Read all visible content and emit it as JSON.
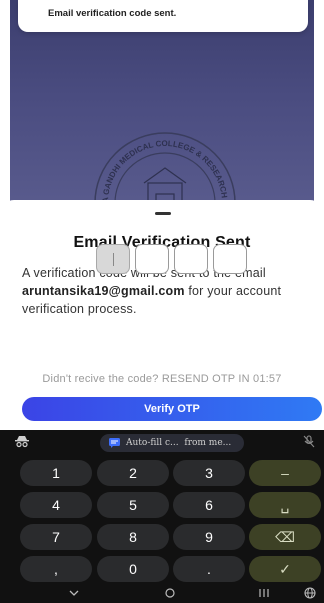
{
  "toast": {
    "message": "Email verification code sent."
  },
  "logo": {
    "text": "A GANDHI MEDICAL COLLEGE & RESEARCH INSTITUTE"
  },
  "sheet": {
    "title": "Email Verification Sent",
    "description_prefix": "A verification code will be sent to the email ",
    "email": "aruntansika19@gmail.com",
    "description_suffix": " for your account verification process.",
    "otp_digits": [
      "",
      "",
      "",
      ""
    ],
    "resend_text": "Didn't recive the code? RESEND OTP IN 01:57",
    "verify_button": "Verify OTP",
    "button_colors": [
      "#3b44e6",
      "#2f7af4"
    ]
  },
  "keyboard": {
    "toolbar": {
      "autofill_label": "Auto-fill c...",
      "autofill_source": "from me...",
      "icons": [
        "incognito-icon",
        "message-icon",
        "mic-off-icon"
      ]
    },
    "keys": {
      "k1": "1",
      "k2": "2",
      "k3": "3",
      "minus": "–",
      "k4": "4",
      "k5": "5",
      "k6": "6",
      "space": "␣",
      "k7": "7",
      "k8": "8",
      "k9": "9",
      "backspace": "⌫",
      "comma": ",",
      "k0": "0",
      "period": ".",
      "enter": "✓"
    }
  },
  "navbar": {
    "icons": [
      "chevron-down-icon",
      "home-icon",
      "recents-icon",
      "globe-icon"
    ]
  }
}
